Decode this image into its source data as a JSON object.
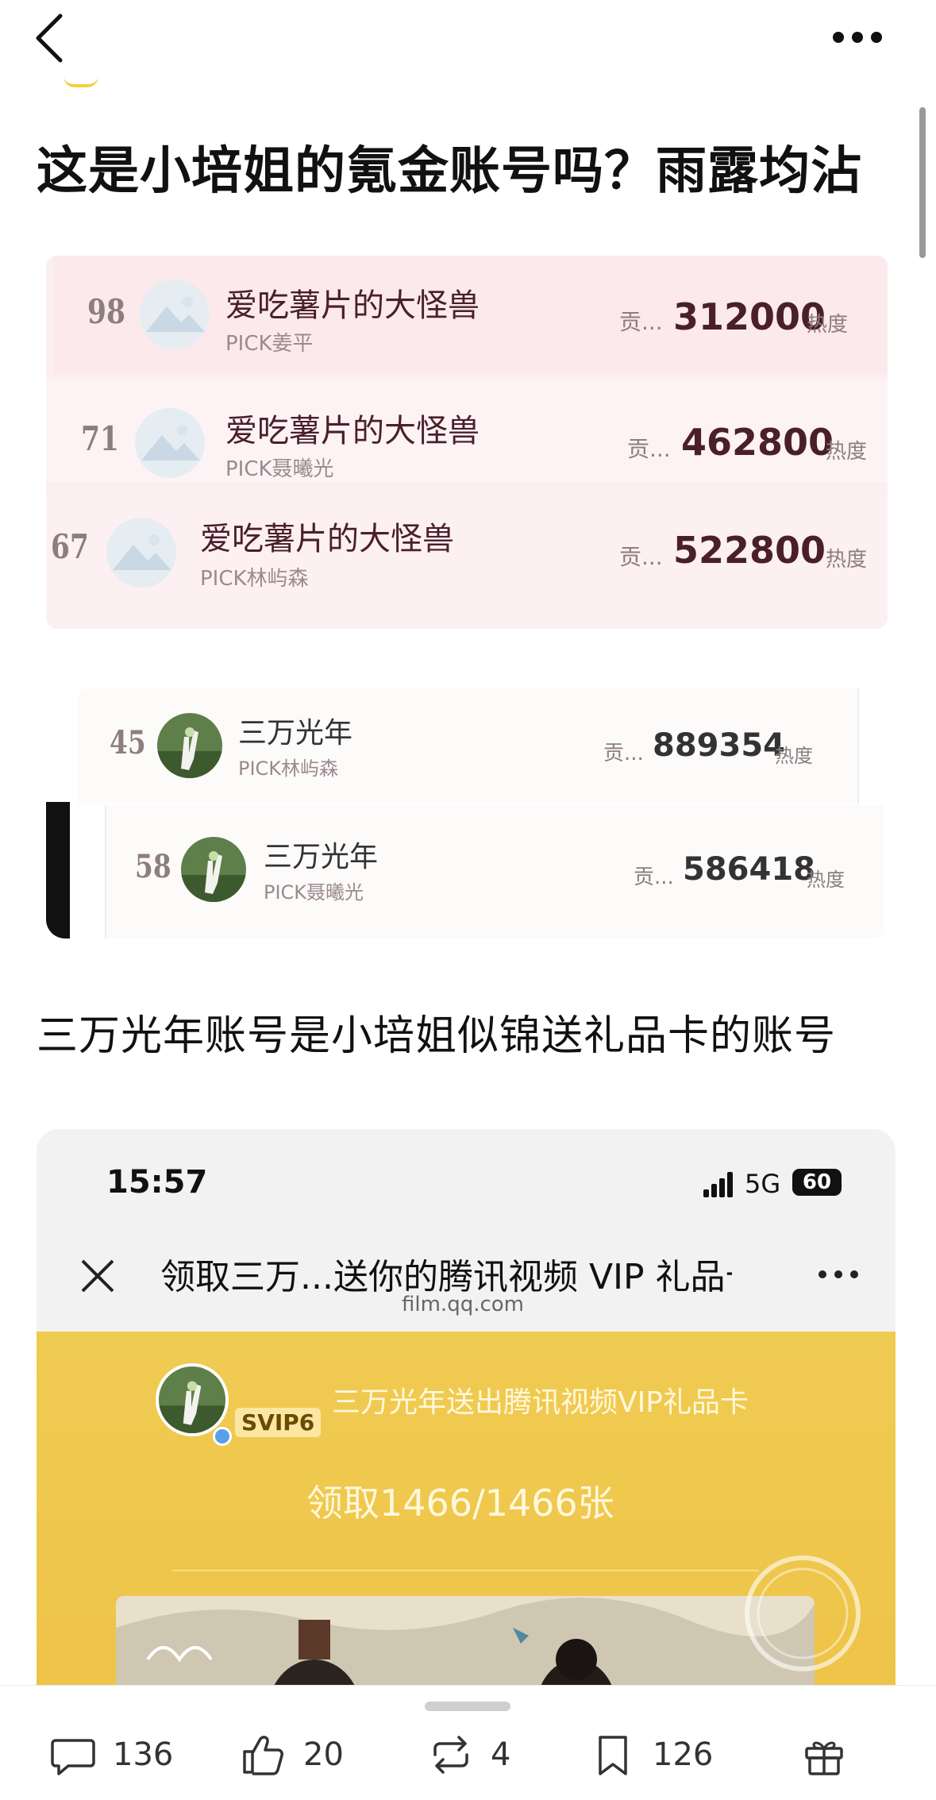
{
  "post": {
    "title": "这是小培姐的氪金账号吗？雨露均沾",
    "caption": "三万光年账号是小培姐似锦送礼品卡的账号"
  },
  "rankings_group_1": [
    {
      "rank": "98",
      "name": "爱吃薯片的大怪兽",
      "pick": "PICK姜平",
      "contrib": "贡...",
      "score": "312000",
      "heat": "热度"
    },
    {
      "rank": "71",
      "name": "爱吃薯片的大怪兽",
      "pick": "PICK聂曦光",
      "contrib": "贡...",
      "score": "462800",
      "heat": "热度"
    },
    {
      "rank": "67",
      "name": "爱吃薯片的大怪兽",
      "pick": "PICK林屿森",
      "contrib": "贡...",
      "score": "522800",
      "heat": "热度"
    }
  ],
  "rankings_group_2": [
    {
      "rank": "45",
      "name": "三万光年",
      "pick": "PICK林屿森",
      "contrib": "贡...",
      "score": "889354",
      "heat": "热度"
    },
    {
      "rank": "58",
      "name": "三万光年",
      "pick": "PICK聂曦光",
      "contrib": "贡...",
      "score": "586418",
      "heat": "热度"
    }
  ],
  "embedded_screenshot": {
    "status_time": "15:57",
    "network": "5G",
    "battery": "60",
    "browser_title": "领取三万...送你的腾讯视频 VIP 礼品卡",
    "browser_url": "film.qq.com",
    "badge": "SVIP6",
    "gift_text": "三万光年送出腾讯视频VIP礼品卡",
    "claim_text": "领取1466/1466张"
  },
  "actions": {
    "comments": "136",
    "likes": "20",
    "reposts": "4",
    "favorites": "126"
  },
  "icons": [
    "back-icon",
    "more-icon",
    "comment-icon",
    "like-icon",
    "repost-icon",
    "favorite-icon",
    "gift-icon"
  ]
}
